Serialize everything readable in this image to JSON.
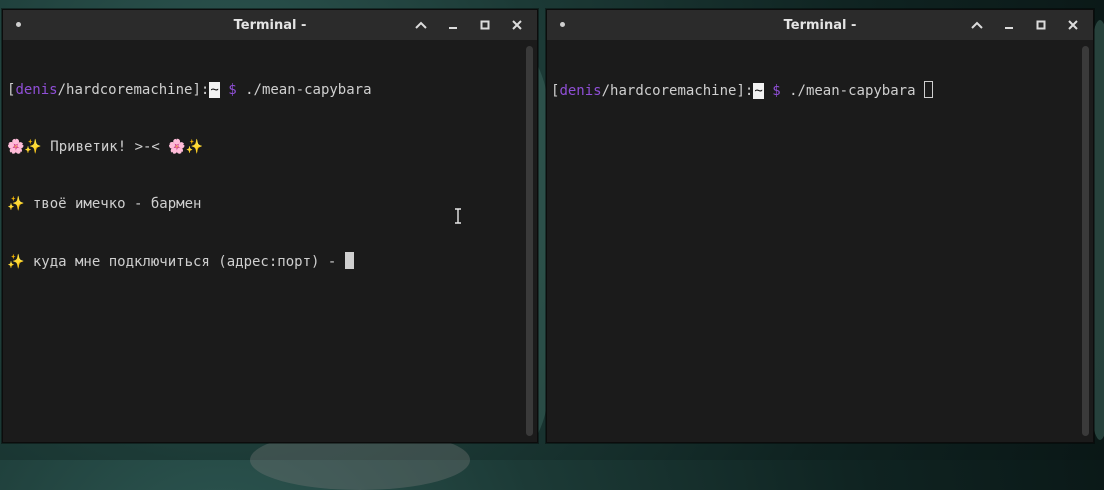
{
  "windows": [
    {
      "title": "Terminal -",
      "prompt": {
        "open_bracket": "[",
        "user": "denis",
        "separator": "/",
        "host": "hardcoremachine",
        "close_bracket": "]",
        "colon": ":",
        "path": "~",
        "dollar": "$",
        "command": "./mean-capybara"
      },
      "output": [
        "🌸✨ Приветик! >-< 🌸✨",
        "✨ твоё имечко - бармен",
        "✨ куда мне подключиться (адрес:порт) - "
      ]
    },
    {
      "title": "Terminal -",
      "prompt": {
        "open_bracket": "[",
        "user": "denis",
        "separator": "/",
        "host": "hardcoremachine",
        "close_bracket": "]",
        "colon": ":",
        "path": "~",
        "dollar": "$",
        "command": "./mean-capybara"
      },
      "output": []
    }
  ],
  "icons": {
    "menu": "menu-dot-icon",
    "maximize": "chevron-up-icon",
    "minimize": "minimize-icon",
    "restore": "restore-icon",
    "close": "close-icon",
    "pointer": "text-cursor-icon"
  },
  "colors": {
    "user": "#8f4fd6",
    "terminal_bg": "#1b1b1b",
    "titlebar_bg": "#2b2b2b"
  }
}
